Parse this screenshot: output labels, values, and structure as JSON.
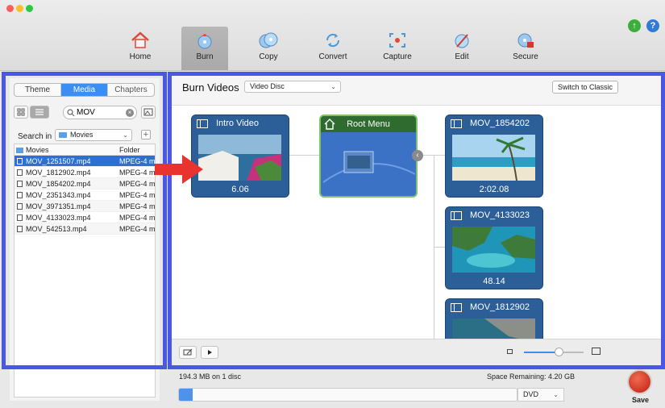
{
  "toolbar": {
    "items": [
      {
        "id": "home",
        "label": "Home",
        "icon": "home-icon"
      },
      {
        "id": "burn",
        "label": "Burn",
        "icon": "burn-disc-icon"
      },
      {
        "id": "copy",
        "label": "Copy",
        "icon": "copy-discs-icon"
      },
      {
        "id": "convert",
        "label": "Convert",
        "icon": "convert-icon"
      },
      {
        "id": "capture",
        "label": "Capture",
        "icon": "capture-icon"
      },
      {
        "id": "edit",
        "label": "Edit",
        "icon": "edit-icon"
      },
      {
        "id": "secure",
        "label": "Secure",
        "icon": "secure-disc-icon"
      }
    ],
    "active": "burn",
    "help": "?"
  },
  "sidebar": {
    "tabs": [
      "Theme",
      "Media",
      "Chapters"
    ],
    "active_tab": "Media",
    "search_value": "MOV",
    "search_in_label": "Search in",
    "search_in_value": "Movies",
    "columns": [
      "Movies",
      "Folder"
    ],
    "files": [
      {
        "name": "MOV_1251507.mp4",
        "type": "MPEG-4 m..."
      },
      {
        "name": "MOV_1812902.mp4",
        "type": "MPEG-4 m..."
      },
      {
        "name": "MOV_1854202.mp4",
        "type": "MPEG-4 m..."
      },
      {
        "name": "MOV_2351343.mp4",
        "type": "MPEG-4 m..."
      },
      {
        "name": "MOV_3971351.mp4",
        "type": "MPEG-4 m..."
      },
      {
        "name": "MOV_4133023.mp4",
        "type": "MPEG-4 m..."
      },
      {
        "name": "MOV_542513.mp4",
        "type": "MPEG-4 m..."
      }
    ],
    "selected_index": 0
  },
  "main": {
    "title": "Burn Videos",
    "disc_type": "Video Disc",
    "classic_button": "Switch to Classic",
    "nodes": {
      "intro": {
        "title": "Intro Video",
        "duration": "6.06"
      },
      "root": {
        "title": "Root Menu"
      },
      "mov1": {
        "title": "MOV_1854202",
        "duration": "2:02.08"
      },
      "mov2": {
        "title": "MOV_4133023",
        "duration": "48.14"
      },
      "mov3": {
        "title": "MOV_1812902"
      }
    },
    "zoom_level": 0.6
  },
  "footer": {
    "size_text": "194.3 MB on 1 disc",
    "space_remaining": "Space Remaining: 4.20 GB",
    "progress": 0.04,
    "media": "DVD",
    "save_label": "Save"
  },
  "colors": {
    "accent": "#3b8ff2",
    "outline": "#4a56e6",
    "node": "#2c5e98",
    "root_header": "#2f6a2f",
    "arrow": "#e8332e",
    "save": "#d4301c"
  }
}
